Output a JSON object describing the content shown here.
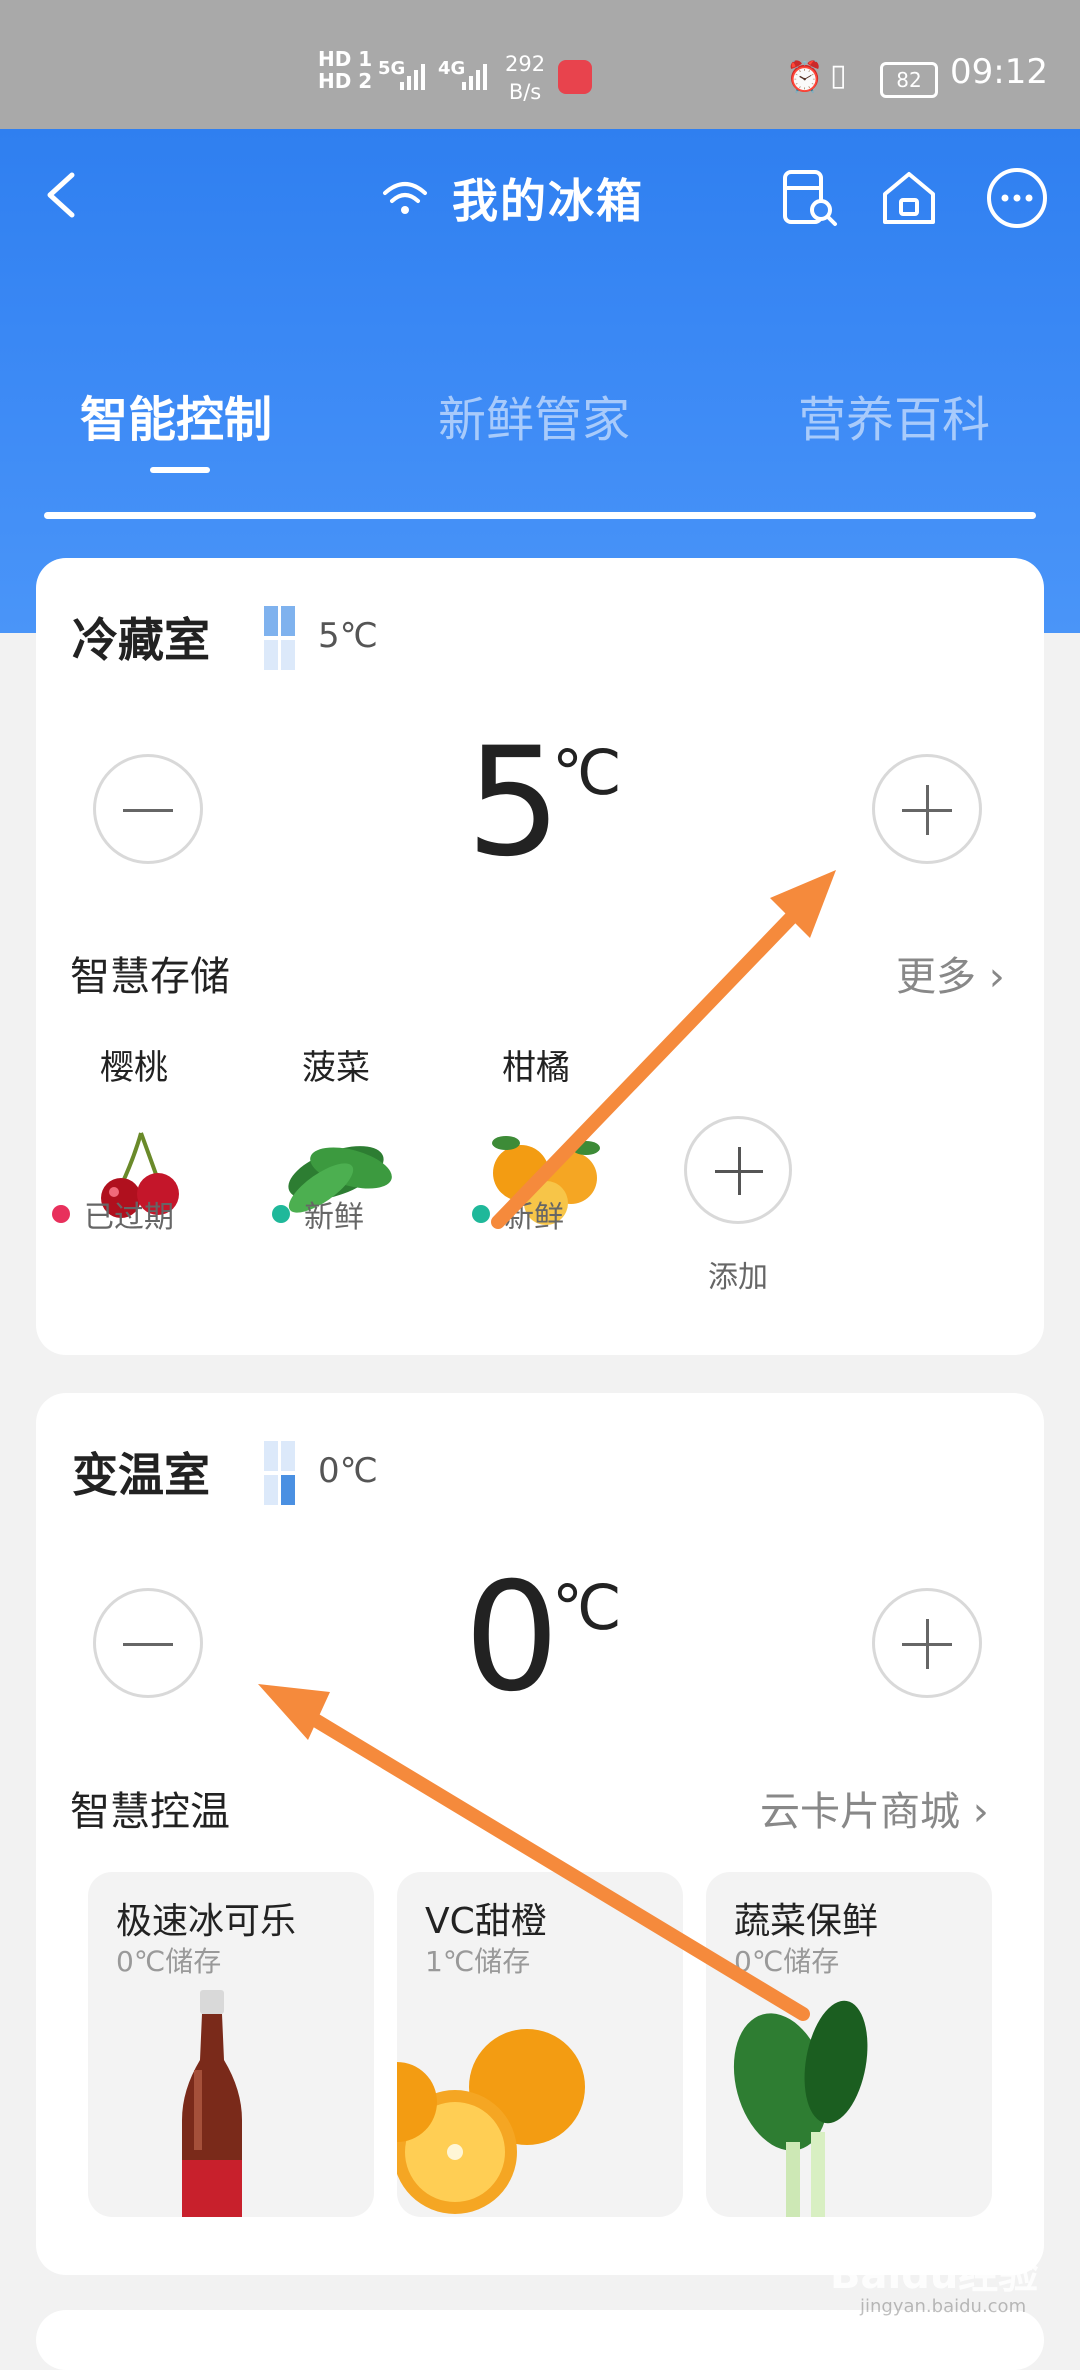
{
  "status_bar": {
    "hd1": "HD 1",
    "hd2": "HD 2",
    "sig1": "5G",
    "sig2": "4G",
    "net_speed": "292",
    "net_unit": "B/s",
    "battery": "82",
    "time": "09:12"
  },
  "header": {
    "title": "我的冰箱",
    "icons": [
      "back-arrow-icon",
      "wifi-icon",
      "fridge-search-icon",
      "home-icon",
      "more-icon"
    ]
  },
  "tabs": [
    {
      "label": "智能控制",
      "active": true
    },
    {
      "label": "新鲜管家",
      "active": false
    },
    {
      "label": "营养百科",
      "active": false
    }
  ],
  "fridge": {
    "name": "冷藏室",
    "small_temp": "5℃",
    "temp": "5",
    "unit": "℃",
    "section_title": "智慧存储",
    "more": "更多",
    "foods": [
      {
        "name": "樱桃",
        "status": "已过期",
        "status_color": "#e8305c"
      },
      {
        "name": "菠菜",
        "status": "新鲜",
        "status_color": "#1fb89a"
      },
      {
        "name": "柑橘",
        "status": "新鲜",
        "status_color": "#1fb89a"
      }
    ],
    "add_label": "添加"
  },
  "variable": {
    "name": "变温室",
    "small_temp": "0℃",
    "temp": "0",
    "unit": "℃",
    "section_title": "智慧控温",
    "more": "云卡片商城",
    "tiles": [
      {
        "name": "极速冰可乐",
        "sub": "0℃储存"
      },
      {
        "name": "VC甜橙",
        "sub": "1℃储存"
      },
      {
        "name": "蔬菜保鲜",
        "sub": "0℃储存"
      }
    ]
  },
  "colors": {
    "accent": "#3a88f5",
    "arrow": "#f58a3c"
  },
  "watermark": {
    "brand": "Baidu经验",
    "url": "jingyan.baidu.com"
  }
}
